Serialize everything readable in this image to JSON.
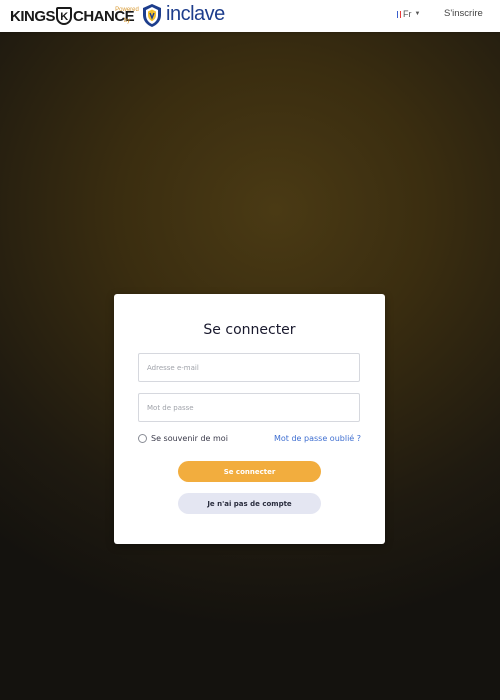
{
  "header": {
    "logo": {
      "left": "KINGS",
      "badge": "K",
      "right": "CHANCE"
    },
    "powered_by": [
      "Powered",
      "by"
    ],
    "inclave_brand": "inclave",
    "language": {
      "flag": [
        "#3a5fcd",
        "#ffffff",
        "#e63b3b"
      ],
      "label": "Fr"
    },
    "signup_label": "S'inscrire"
  },
  "login": {
    "title": "Se connecter",
    "email_placeholder": "Adresse e-mail",
    "password_placeholder": "Mot de passe",
    "remember_label": "Se souvenir de moi",
    "forgot_label": "Mot de passe oublié ?",
    "submit_label": "Se connecter",
    "no_account_label": "Je n'ai pas de compte"
  },
  "colors": {
    "accent": "#f2ad3e",
    "link": "#3f6fd1",
    "brand_blue": "#1d3d8c"
  }
}
